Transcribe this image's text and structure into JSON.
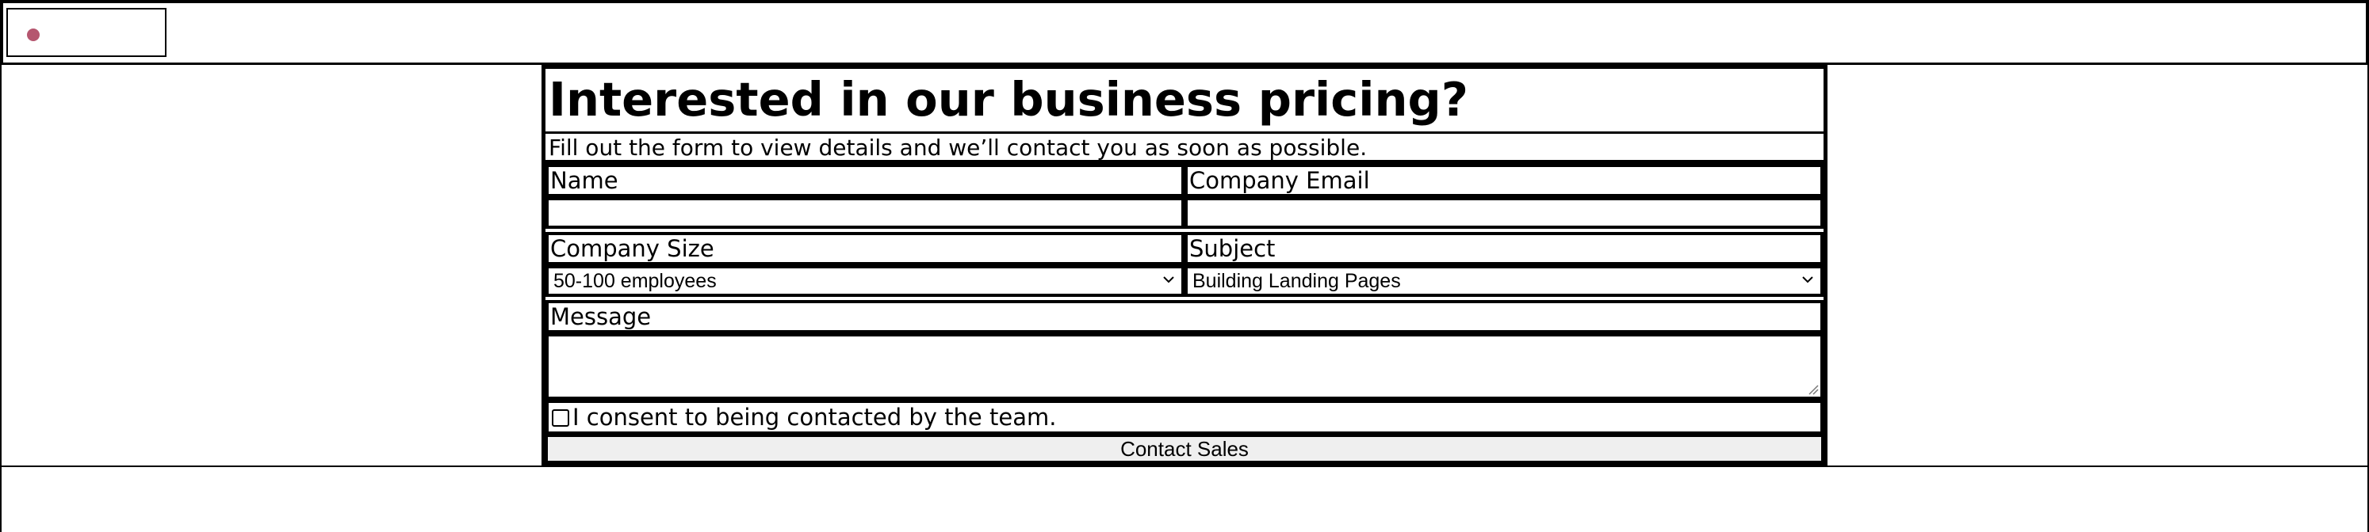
{
  "header": {
    "logo_icon": "logo-dot-icon",
    "logo_color": "#b5566f"
  },
  "form": {
    "title": "Interested in our business pricing?",
    "subtitle": "Fill out the form to view details and we’ll contact you as soon as possible.",
    "name": {
      "label": "Name",
      "value": ""
    },
    "email": {
      "label": "Company Email",
      "value": ""
    },
    "company_size": {
      "label": "Company Size",
      "selected": "50-100 employees"
    },
    "subject": {
      "label": "Subject",
      "selected": "Building Landing Pages"
    },
    "message": {
      "label": "Message",
      "value": ""
    },
    "consent": {
      "label": "I consent to being contacted by the team.",
      "checked": false
    },
    "submit_label": "Contact Sales"
  }
}
